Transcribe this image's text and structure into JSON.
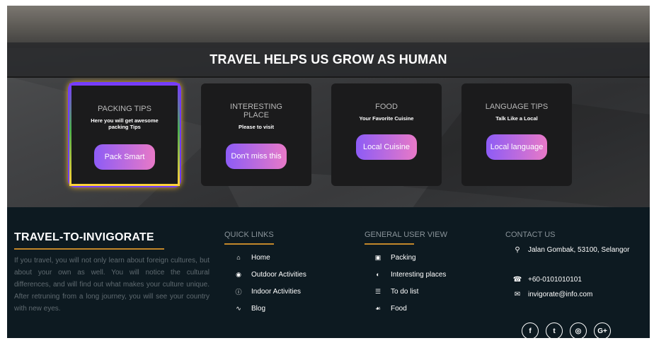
{
  "hero": {
    "title": "TRAVEL HELPS US GROW AS HUMAN",
    "cards": [
      {
        "title": "PACKING TIPS",
        "subtitle": "Here you will get awesome packing Tips",
        "button": "Pack Smart"
      },
      {
        "title": "INTERESTING PLACE",
        "subtitle": "Please to visit",
        "button": "Don't miss this"
      },
      {
        "title": "FOOD",
        "subtitle": "Your Favorite Cuisine",
        "button": "Local Cuisine"
      },
      {
        "title": "LANGUAGE TIPS",
        "subtitle": "Talk Like a Local",
        "button": "Local language"
      }
    ]
  },
  "footer": {
    "brand": {
      "title": "TRAVEL-TO-INVIGORATE",
      "text": "If you travel, you will not only learn about foreign cultures, but about your own as well. You will notice the cultural differences, and will find out what makes your culture unique. After retruning from a long journey, you will see your country with new eyes."
    },
    "quick_links": {
      "heading": "QUICK LINKS",
      "items": [
        {
          "label": "Home",
          "icon": "home-icon"
        },
        {
          "label": "Outdoor Activities",
          "icon": "user-circle-icon"
        },
        {
          "label": "Indoor Activities",
          "icon": "info-icon"
        },
        {
          "label": "Blog",
          "icon": "rss-icon"
        }
      ]
    },
    "general": {
      "heading": "GENERAL USER VIEW",
      "items": [
        {
          "label": "Packing",
          "icon": "briefcase-icon"
        },
        {
          "label": "Interesting places",
          "icon": "globe-icon"
        },
        {
          "label": "To do list",
          "icon": "list-icon"
        },
        {
          "label": "Food",
          "icon": "utensils-icon"
        }
      ]
    },
    "contact": {
      "heading": "CONTACT US",
      "address": "Jalan Gombak, 53100, Selangor",
      "phone": "+60-0101010101",
      "email": "invigorate@info.com"
    },
    "socials": [
      {
        "icon": "facebook-icon",
        "glyph": "f"
      },
      {
        "icon": "twitter-icon",
        "glyph": "t"
      },
      {
        "icon": "instagram-icon",
        "glyph": "◎"
      },
      {
        "icon": "google-plus-icon",
        "glyph": "G+"
      }
    ]
  }
}
